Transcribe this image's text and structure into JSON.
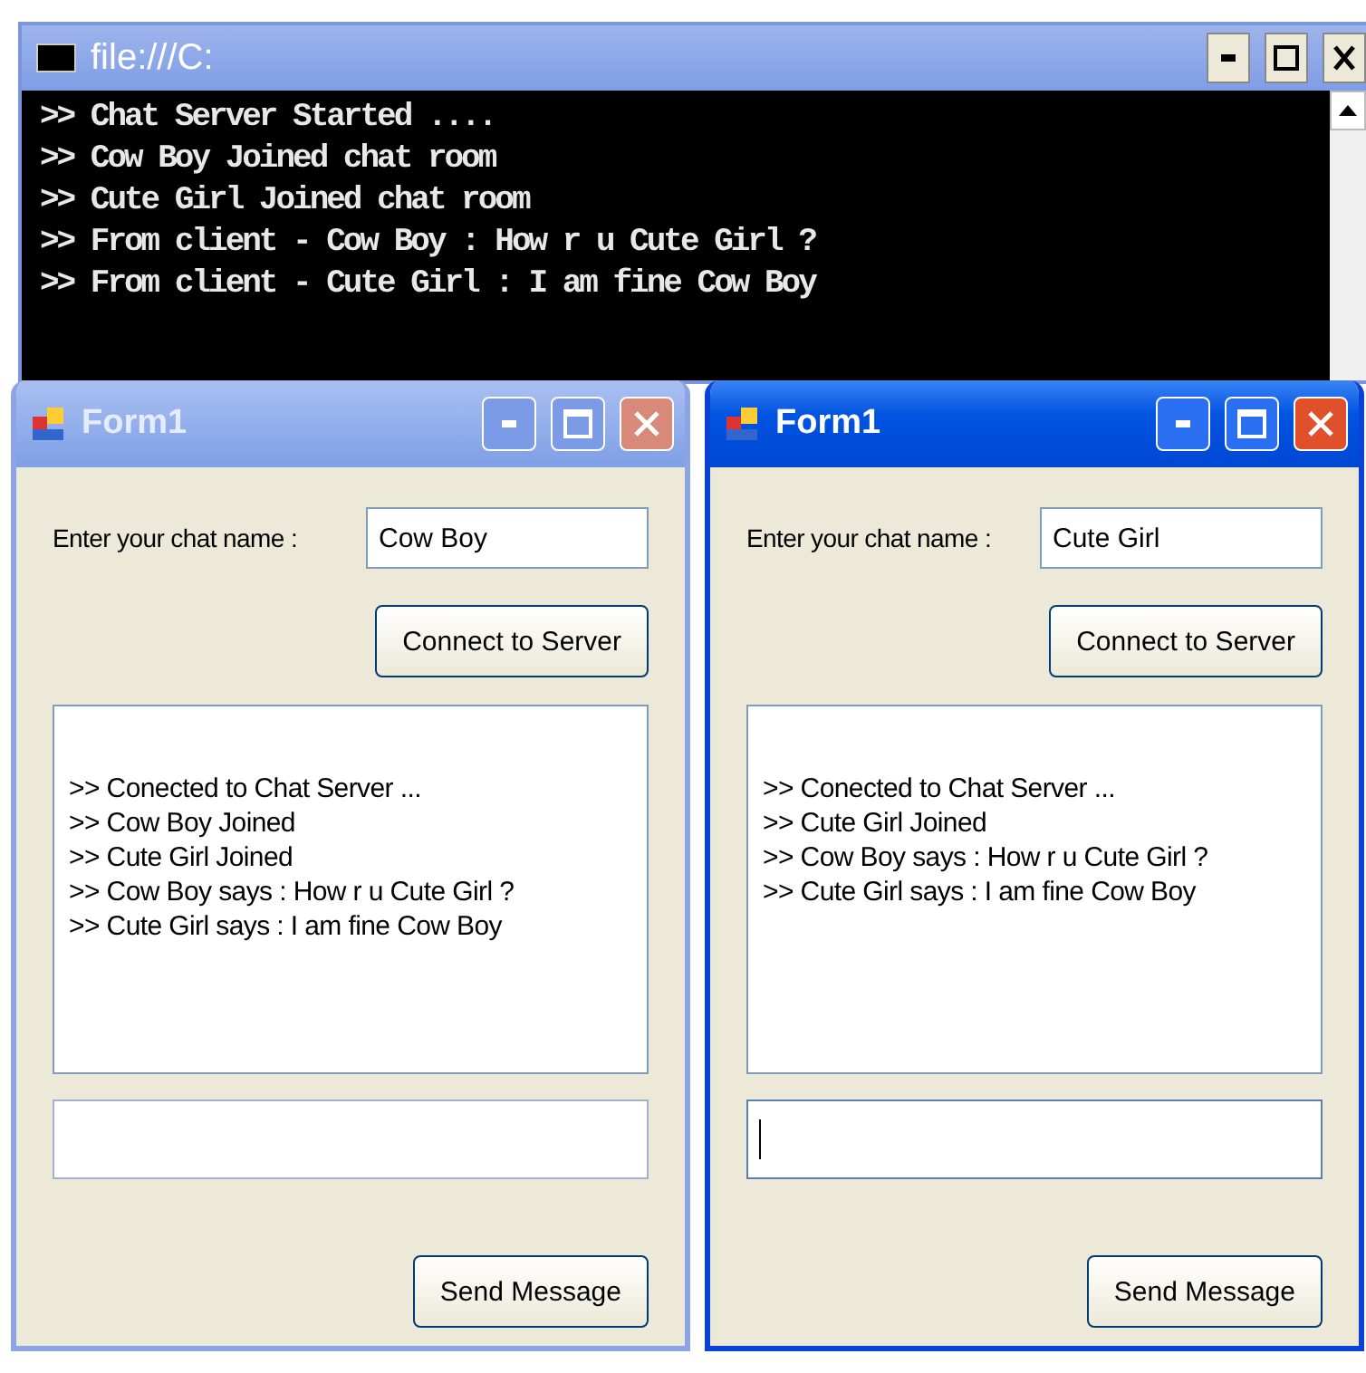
{
  "console": {
    "title": "file:///C:",
    "lines": [
      ">> Chat Server Started ....",
      ">> Cow Boy Joined chat room",
      ">> Cute Girl Joined chat room",
      ">> From client - Cow Boy : How r u Cute Girl ?",
      ">> From client - Cute Girl : I am fine Cow Boy"
    ]
  },
  "forms": [
    {
      "title": "Form1",
      "active": false,
      "name_label": "Enter your chat name :",
      "name_value": "Cow Boy",
      "connect_button": "Connect to Server",
      "messages": [
        ">> Conected to Chat Server ...",
        ">> Cow Boy Joined",
        ">> Cute Girl Joined",
        ">> Cow Boy says : How r u Cute Girl ?",
        ">> Cute Girl says : I am fine Cow Boy"
      ],
      "message_focused": false,
      "send_button": "Send Message"
    },
    {
      "title": "Form1",
      "active": true,
      "name_label": "Enter your chat name :",
      "name_value": "Cute Girl",
      "connect_button": "Connect to Server",
      "messages": [
        ">> Conected to Chat Server ...",
        ">> Cute Girl Joined",
        ">> Cow Boy says : How r u Cute Girl ?",
        ">> Cute Girl says : I am fine Cow Boy"
      ],
      "message_focused": true,
      "send_button": "Send Message"
    }
  ]
}
